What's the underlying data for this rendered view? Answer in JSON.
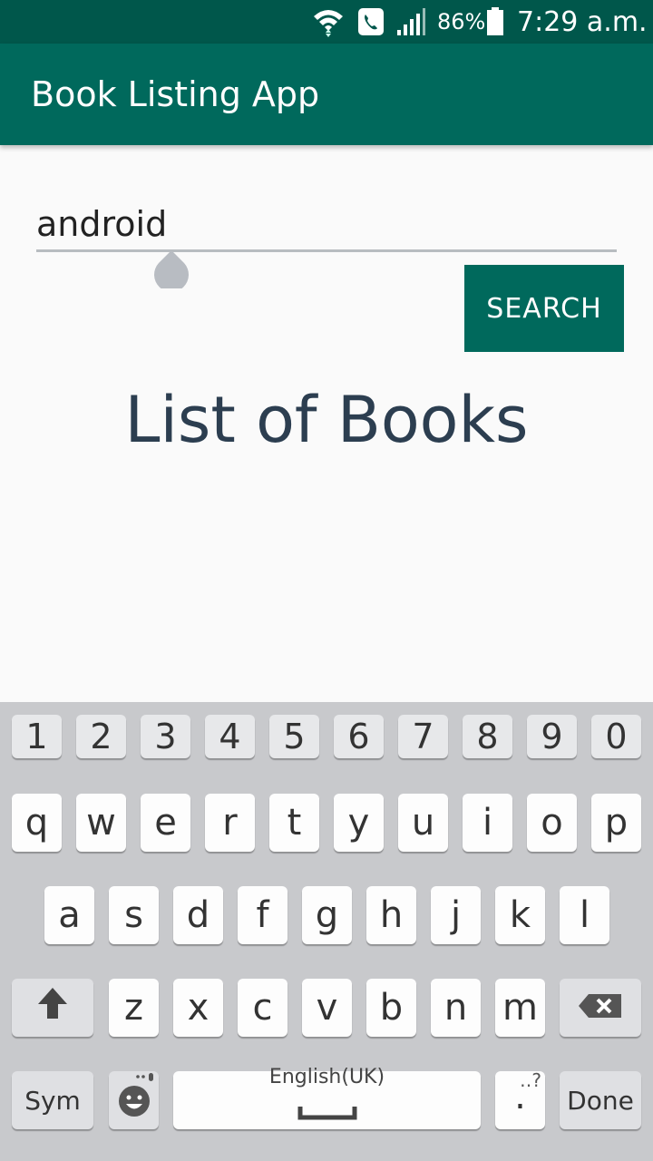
{
  "status_bar": {
    "battery_percent": "86%",
    "time": "7:29 a.m.",
    "icons": [
      "wifi-icon",
      "phone-call-icon",
      "signal-icon",
      "battery-icon"
    ]
  },
  "app_bar": {
    "title": "Book Listing App"
  },
  "search": {
    "value": "android",
    "button_label": "SEARCH"
  },
  "main": {
    "heading": "List of Books"
  },
  "keyboard": {
    "numbers": [
      "1",
      "2",
      "3",
      "4",
      "5",
      "6",
      "7",
      "8",
      "9",
      "0"
    ],
    "row1": [
      "q",
      "w",
      "e",
      "r",
      "t",
      "y",
      "u",
      "i",
      "o",
      "p"
    ],
    "row2": [
      "a",
      "s",
      "d",
      "f",
      "g",
      "h",
      "j",
      "k",
      "l"
    ],
    "row3": [
      "z",
      "x",
      "c",
      "v",
      "b",
      "n",
      "m"
    ],
    "sym_label": "Sym",
    "space_label": "English(UK)",
    "period_label": ".",
    "period_hint": "‥?",
    "done_label": "Done"
  },
  "colors": {
    "primary": "#00695c",
    "primary_dark": "#00574b",
    "heading": "#2c3e50"
  }
}
